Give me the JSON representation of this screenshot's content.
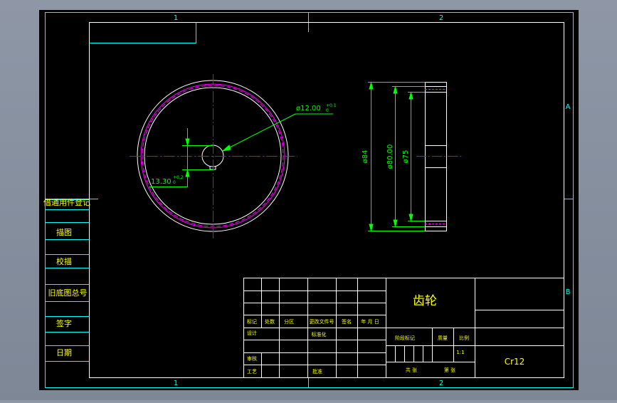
{
  "colors": {
    "background": "#000000",
    "frame": "#00ffff",
    "outline": "#ffffff",
    "text": "#ffff00",
    "dimension": "#00ff00",
    "centerline": "#ff0000",
    "hidden": "#ff00ff",
    "outer_strip": "#8a94a4"
  },
  "zones": {
    "top_left": "1",
    "top_right": "2",
    "bottom_left": "1",
    "bottom_right": "2",
    "right_top": "A",
    "right_bottom": "B"
  },
  "dimensions": {
    "bore_value": "ø12.00",
    "bore_tol_upper": "+0.1",
    "bore_tol_lower": "0",
    "keyway_value": "13.30",
    "keyway_tol_upper": "+0.2",
    "keyway_tol_lower": "0",
    "dia_84": "ø84",
    "dia_80": "ø80.00",
    "dia_75": "ø75"
  },
  "left_strip": [
    "借通用件登记",
    "描图",
    "校描",
    "旧底图总号",
    "签字",
    "日期"
  ],
  "title_block": {
    "part_name": "齿轮",
    "material": "Cr12",
    "header_labels": [
      "标记",
      "处数",
      "分区",
      "更改文件号",
      "签名",
      "年 月 日"
    ],
    "design": "设计",
    "standardization": "标准化",
    "review": "审核",
    "process": "工艺",
    "approve": "批准",
    "stage_mark": "阶段标记",
    "weight": "质量",
    "scale_label": "比例",
    "scale_value": "1:1",
    "sheets_total": "共   张",
    "sheet_no": "第   张"
  }
}
